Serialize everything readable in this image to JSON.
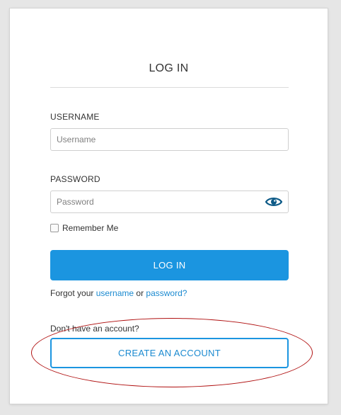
{
  "login_form": {
    "title": "LOG IN",
    "username": {
      "label": "USERNAME",
      "placeholder": "Username",
      "value": ""
    },
    "password": {
      "label": "PASSWORD",
      "placeholder": "Password",
      "value": "",
      "toggle_icon": "eye-icon"
    },
    "remember_me": {
      "label": "Remember Me",
      "checked": false
    },
    "submit_label": "LOG IN",
    "forgot": {
      "prefix": "Forgot your ",
      "username_link": "username",
      "middle": " or ",
      "password_link": "password?"
    },
    "signup": {
      "prompt": "Don't have an account?",
      "create_label": "CREATE AN ACCOUNT"
    }
  },
  "annotation": {
    "shape": "ellipse",
    "color": "#b01010",
    "target": "create-account-button"
  },
  "colors": {
    "accent": "#1b95e0",
    "link": "#1b8ad0",
    "eye_icon": "#0d5a87",
    "background": "#e6e6e6"
  }
}
